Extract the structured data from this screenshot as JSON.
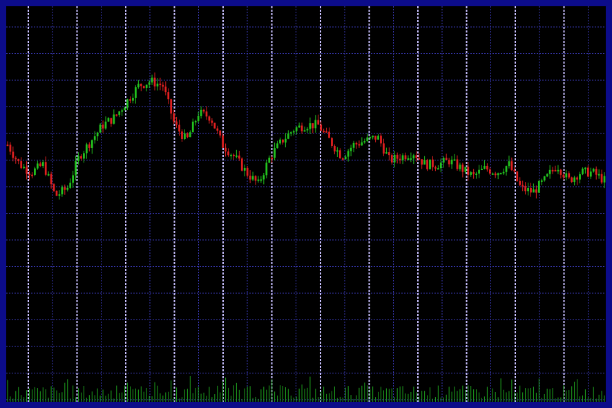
{
  "colors": {
    "frame": "#0c0c8a",
    "background": "#000000",
    "grid_major": "#c8c0ff",
    "grid_minor": "#3a3ab8",
    "up": "#22c21e",
    "down": "#e02020",
    "volume": "#1fa51f"
  },
  "chart_data": {
    "type": "candlestick",
    "title": "",
    "xlabel": "",
    "ylabel": "",
    "grid": true,
    "legend": "none",
    "axes_labels_visible": false,
    "ylim": [
      0,
      100
    ],
    "close_path": [
      [
        0,
        65
      ],
      [
        2,
        60
      ],
      [
        4,
        58
      ],
      [
        6,
        60
      ],
      [
        8,
        52
      ],
      [
        10,
        54
      ],
      [
        12,
        62
      ],
      [
        14,
        66
      ],
      [
        16,
        70
      ],
      [
        18,
        72
      ],
      [
        20,
        76
      ],
      [
        22,
        80
      ],
      [
        24,
        81
      ],
      [
        26,
        80
      ],
      [
        28,
        70
      ],
      [
        30,
        66
      ],
      [
        32,
        73
      ],
      [
        34,
        72
      ],
      [
        36,
        65
      ],
      [
        38,
        62
      ],
      [
        40,
        58
      ],
      [
        42,
        55
      ],
      [
        44,
        62
      ],
      [
        46,
        66
      ],
      [
        48,
        69
      ],
      [
        50,
        70
      ],
      [
        52,
        70
      ],
      [
        54,
        66
      ],
      [
        56,
        62
      ],
      [
        58,
        65
      ],
      [
        60,
        66
      ],
      [
        62,
        67
      ],
      [
        64,
        61
      ],
      [
        66,
        62
      ],
      [
        68,
        63
      ],
      [
        70,
        60
      ],
      [
        72,
        60
      ],
      [
        74,
        61
      ],
      [
        76,
        59
      ],
      [
        78,
        57
      ],
      [
        80,
        59
      ],
      [
        82,
        58
      ],
      [
        84,
        60
      ],
      [
        86,
        54
      ],
      [
        88,
        53
      ],
      [
        90,
        56
      ],
      [
        92,
        60
      ],
      [
        94,
        56
      ],
      [
        96,
        58
      ],
      [
        98,
        58
      ],
      [
        100,
        56
      ]
    ],
    "candle_count": 220,
    "volume_present": true
  }
}
